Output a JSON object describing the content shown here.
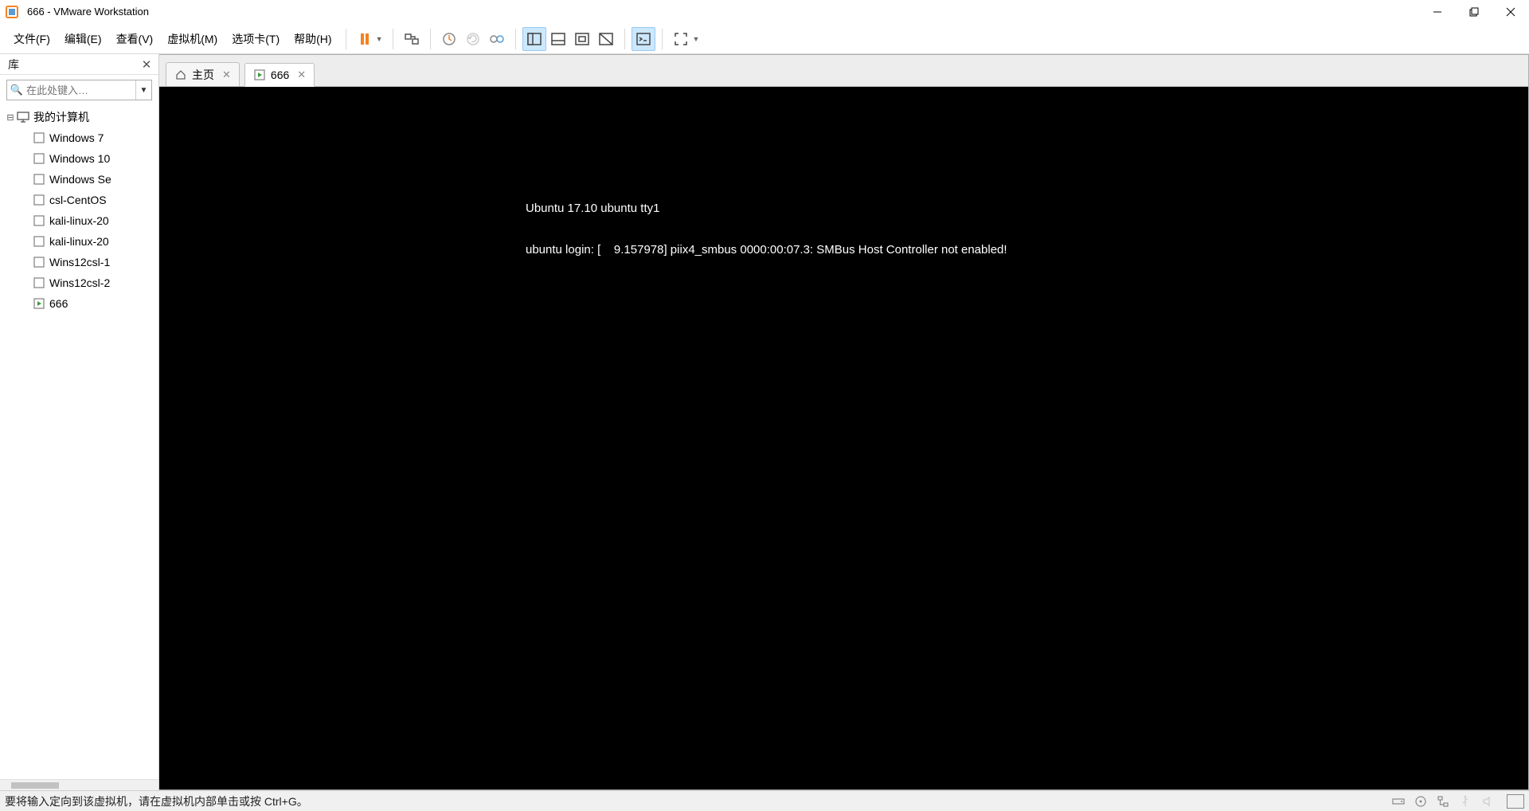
{
  "window": {
    "title": "666 - VMware Workstation"
  },
  "menus": {
    "file": "文件(F)",
    "edit": "编辑(E)",
    "view": "查看(V)",
    "vm": "虚拟机(M)",
    "tabs": "选项卡(T)",
    "help": "帮助(H)"
  },
  "library": {
    "title": "库",
    "search_placeholder": "在此处键入…",
    "root": "我的计算机",
    "items": [
      {
        "label": "Windows 7"
      },
      {
        "label": "Windows 10"
      },
      {
        "label": "Windows Se"
      },
      {
        "label": "csl-CentOS"
      },
      {
        "label": "kali-linux-20"
      },
      {
        "label": "kali-linux-20"
      },
      {
        "label": "Wins12csl-1"
      },
      {
        "label": "Wins12csl-2"
      },
      {
        "label": "666"
      }
    ]
  },
  "tabs": {
    "home": "主页",
    "active": "666"
  },
  "terminal": {
    "line1": "Ubuntu 17.10 ubuntu tty1",
    "line2": "ubuntu login: [    9.157978] piix4_smbus 0000:00:07.3: SMBus Host Controller not enabled!"
  },
  "statusbar": {
    "text": "要将输入定向到该虚拟机，请在虚拟机内部单击或按 Ctrl+G。"
  }
}
